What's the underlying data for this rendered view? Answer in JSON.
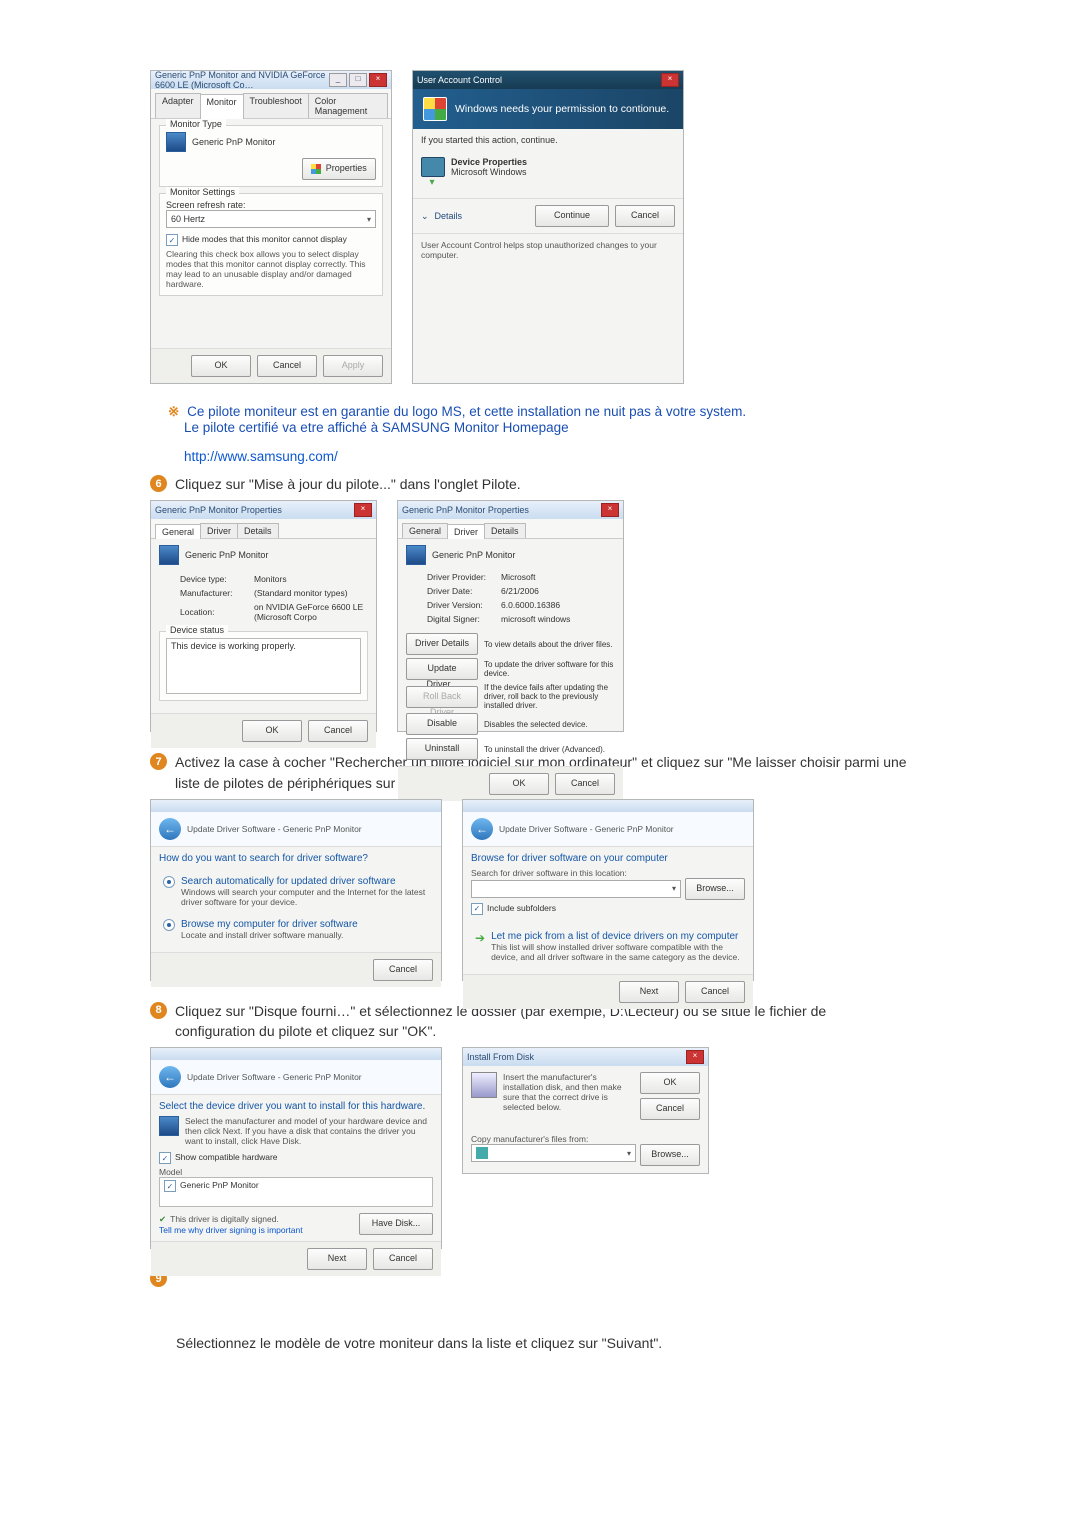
{
  "dlg1": {
    "title": "Generic PnP Monitor and NVIDIA GeForce 6600 LE (Microsoft Co…",
    "tabs": {
      "adapter": "Adapter",
      "monitor": "Monitor",
      "troubleshoot": "Troubleshoot",
      "color": "Color Management"
    },
    "monitor_type_lbl": "Monitor Type",
    "monitor_type_val": "Generic PnP Monitor",
    "properties_btn": "Properties",
    "settings_lbl": "Monitor Settings",
    "refresh_lbl": "Screen refresh rate:",
    "refresh_val": "60 Hertz",
    "hide_modes_lbl": "Hide modes that this monitor cannot display",
    "hide_modes_desc": "Clearing this check box allows you to select display modes that this monitor cannot display correctly. This may lead to an unusable display and/or damaged hardware.",
    "ok": "OK",
    "cancel": "Cancel",
    "apply": "Apply"
  },
  "uac": {
    "title": "User Account Control",
    "headline": "Windows needs your permission to contionue.",
    "if_started": "If you started this action, continue.",
    "devprop": "Device Properties",
    "mswin": "Microsoft Windows",
    "details": "Details",
    "continue": "Continue",
    "cancel": "Cancel",
    "footer": "User Account Control helps stop unauthorized changes to your computer."
  },
  "note": {
    "garantie": "Ce pilote moniteur est en garantie du logo MS, et cette installation ne nuit pas à votre system.",
    "certifie": "Le pilote certifié va etre affiché à SAMSUNG Monitor Homepage",
    "url": "http://www.samsung.com/"
  },
  "steps": {
    "s6": "Cliquez sur \"Mise à jour du pilote...\" dans l'onglet Pilote.",
    "s7": "Activez la case à cocher \"Rechercher un pilote logiciel sur mon ordinateur\" et cliquez sur \"Me laisser choisir parmi une liste de pilotes de périphériques sur mon ordinateur\".",
    "s8": "Cliquez sur \"Disque fourni…\" et sélectionnez le dossier (par exemple, D:\\Lecteur) où se situe le fichier de configuration du pilote et cliquez sur \"OK\".",
    "s9_last": "Sélectionnez le modèle de votre moniteur dans la liste et cliquez sur \"Suivant\"."
  },
  "prop_general": {
    "title": "Generic PnP Monitor Properties",
    "tabs": {
      "general": "General",
      "driver": "Driver",
      "details": "Details"
    },
    "device_name": "Generic PnP Monitor",
    "type_lbl": "Device type:",
    "type_val": "Monitors",
    "manu_lbl": "Manufacturer:",
    "manu_val": "(Standard monitor types)",
    "loc_lbl": "Location:",
    "loc_val": "on NVIDIA GeForce 6600 LE (Microsoft Corpo",
    "status_lbl": "Device status",
    "status_val": "This device is working properly.",
    "ok": "OK",
    "cancel": "Cancel"
  },
  "prop_driver": {
    "title": "Generic PnP Monitor Properties",
    "device_name": "Generic PnP Monitor",
    "prov_lbl": "Driver Provider:",
    "prov_val": "Microsoft",
    "date_lbl": "Driver Date:",
    "date_val": "6/21/2006",
    "ver_lbl": "Driver Version:",
    "ver_val": "6.0.6000.16386",
    "sign_lbl": "Digital Signer:",
    "sign_val": "microsoft windows",
    "btn_details": "Driver Details",
    "btn_details_d": "To view details about the driver files.",
    "btn_update": "Update Driver...",
    "btn_update_d": "To update the driver software for this device.",
    "btn_rollback": "Roll Back Driver",
    "btn_rollback_d": "If the device fails after updating the driver, roll back to the previously installed driver.",
    "btn_disable": "Disable",
    "btn_disable_d": "Disables the selected device.",
    "btn_uninstall": "Uninstall",
    "btn_uninstall_d": "To uninstall the driver (Advanced).",
    "ok": "OK",
    "cancel": "Cancel"
  },
  "wiz1": {
    "bread": "Update Driver Software - Generic PnP Monitor",
    "q": "How do you want to search for driver software?",
    "opt1_t": "Search automatically for updated driver software",
    "opt1_d": "Windows will search your computer and the Internet for the latest driver software for your device.",
    "opt2_t": "Browse my computer for driver software",
    "opt2_d": "Locate and install driver software manually.",
    "cancel": "Cancel"
  },
  "wiz2": {
    "bread": "Update Driver Software - Generic PnP Monitor",
    "h": "Browse for driver software on your computer",
    "search_lbl": "Search for driver software in this location:",
    "browse": "Browse...",
    "include": "Include subfolders",
    "pick_t": "Let me pick from a list of device drivers on my computer",
    "pick_d": "This list will show installed driver software compatible with the device, and all driver software in the same category as the device.",
    "next": "Next",
    "cancel": "Cancel"
  },
  "wiz3": {
    "bread": "Update Driver Software - Generic PnP Monitor",
    "h": "Select the device driver you want to install for this hardware.",
    "desc": "Select the manufacturer and model of your hardware device and then click Next. If you have a disk that contains the driver you want to install, click Have Disk.",
    "show_compat": "Show compatible hardware",
    "model_lbl": "Model",
    "model_val": "Generic PnP Monitor",
    "signed": "This driver is digitally signed.",
    "tellme": "Tell me why driver signing is important",
    "have_disk": "Have Disk...",
    "next": "Next",
    "cancel": "Cancel"
  },
  "install": {
    "title": "Install From Disk",
    "desc": "Insert the manufacturer's installation disk, and then make sure that the correct drive is selected below.",
    "ok": "OK",
    "cancel": "Cancel",
    "copy_lbl": "Copy manufacturer's files from:",
    "browse": "Browse..."
  }
}
